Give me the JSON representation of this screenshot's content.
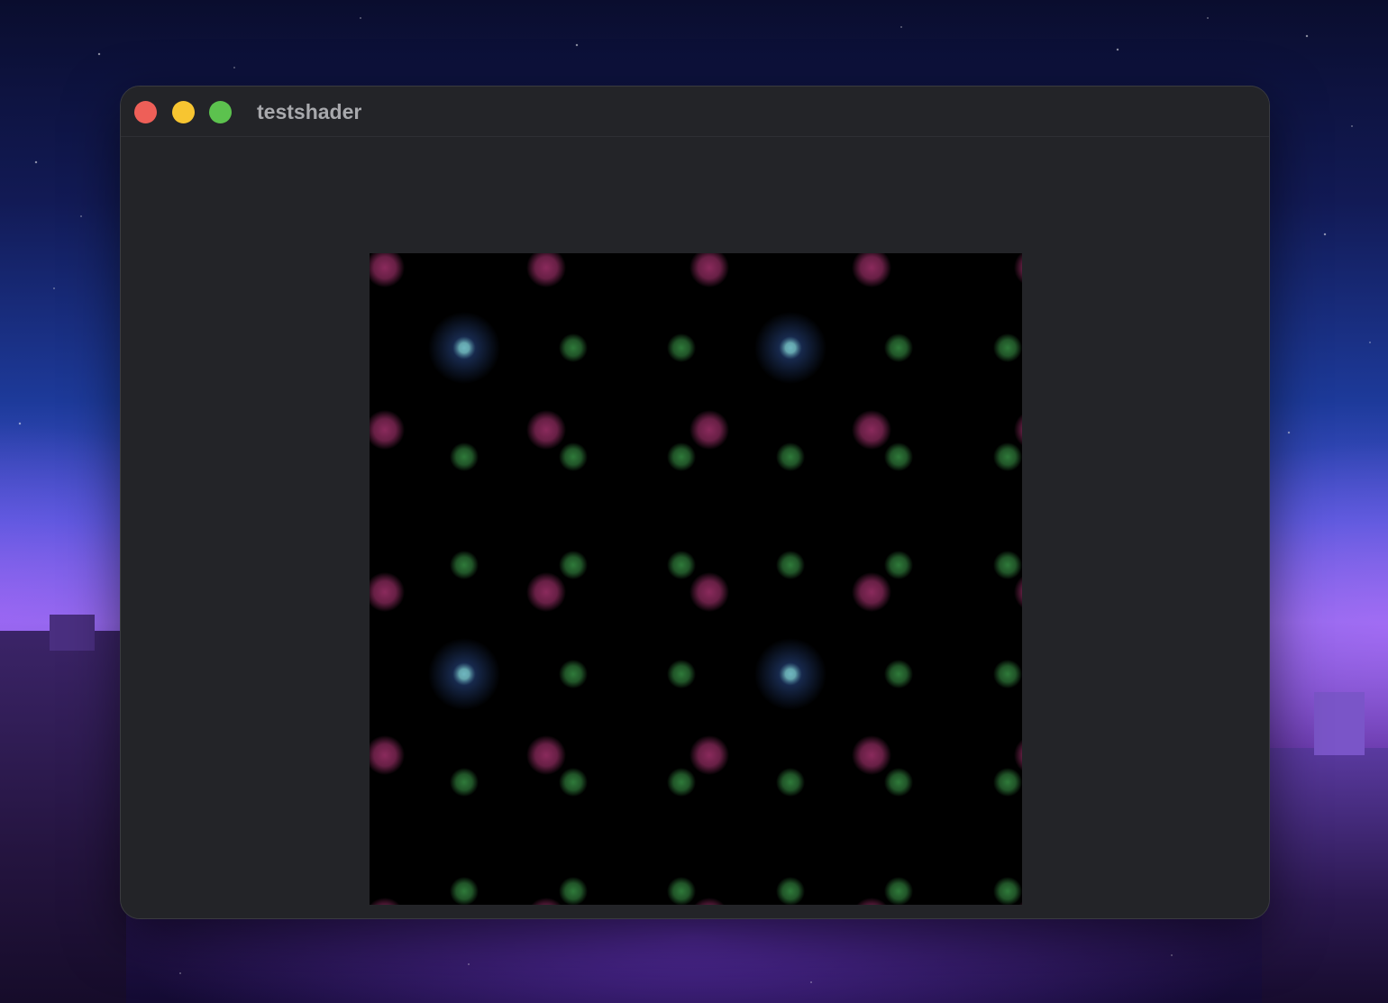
{
  "window": {
    "title": "testshader"
  },
  "traffic_lights": {
    "close_color": "#ee5f58",
    "minimize_color": "#f7c531",
    "zoom_color": "#5cc24e"
  },
  "shader_colors": {
    "magenta": "#8a2a5c",
    "green": "#2f7a3a",
    "blue_core": "#6fb7c0",
    "blue_halo": "#2a4a8a",
    "background": "#000000"
  }
}
